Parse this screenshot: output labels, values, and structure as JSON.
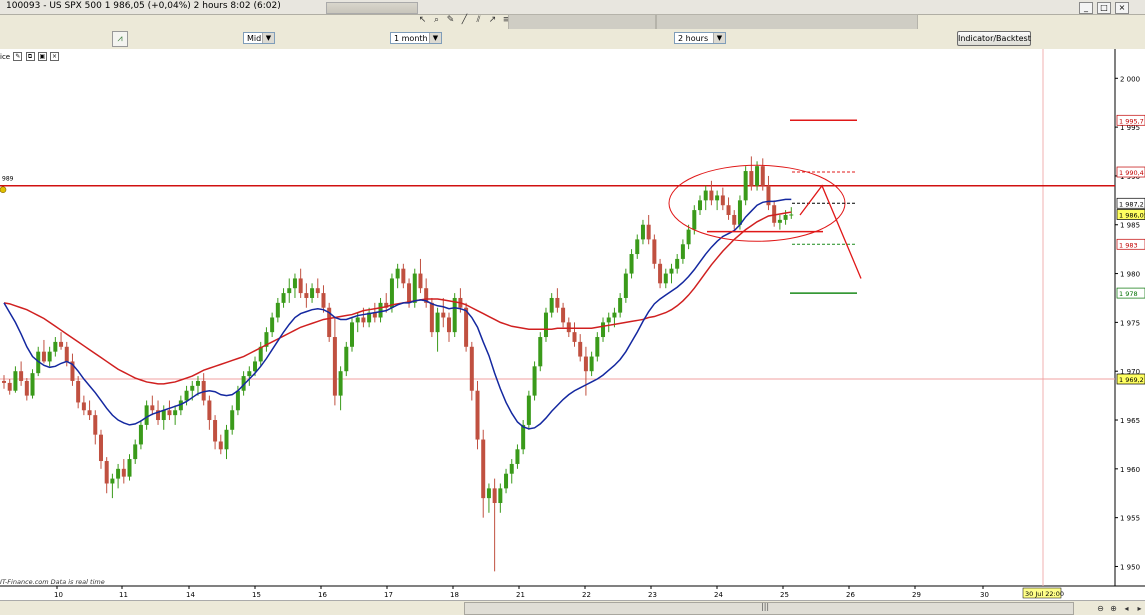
{
  "window": {
    "title": "100093 - US SPX 500     1 986,05 (+0,04%)     2 hours   8:02 (6:02)"
  },
  "toolbar": {
    "icons": [
      "cursor-icon",
      "zoom-icon",
      "draw-icon",
      "line-icon",
      "channel-icon",
      "trendline-icon",
      "fib-icon",
      "fan-icon",
      "text-icon",
      "arrow-icon",
      "delete-icon",
      "settings-icon",
      "chart-icon"
    ]
  },
  "options": {
    "price_mode": "Mid",
    "period": "1 month",
    "interval": "2 hours",
    "indicator_button": "Indicator/Backtest",
    "legend_label": "ice",
    "level_tag": "989"
  },
  "footer": {
    "source": "IT-Finance.com  Data is real time",
    "scroll_grip": "|||"
  },
  "colors": {
    "bull": "#3a9a1a",
    "bear": "#c05040",
    "sma_fast": "#1428a0",
    "sma_slow": "#d02020",
    "annotation_red": "#e01818",
    "annotation_green": "#1a8a1a"
  },
  "chart_data": {
    "type": "candlestick",
    "instrument": "US SPX 500",
    "last_price": 1986.05,
    "change_pct": 0.04,
    "ylim": [
      1948,
      2003
    ],
    "y_ticks": [
      "2 000",
      "1 995",
      "1 990",
      "1 985",
      "1 980",
      "1 975",
      "1 970",
      "1 965",
      "1 960",
      "1 955",
      "1 950"
    ],
    "x_ticks": [
      "10",
      "11",
      "14",
      "15",
      "16",
      "17",
      "18",
      "21",
      "22",
      "23",
      "24",
      "25",
      "26",
      "29",
      "30"
    ],
    "x_highlight": "30 Jul 22:00",
    "price_labels": [
      "1 995,7",
      "1 990,4",
      "1 987,2",
      "1 986,05",
      "1 983",
      "1 978",
      "1 969,2"
    ],
    "levels": {
      "resistance": 1989,
      "support": 1969.2,
      "target_high": 1995.7,
      "stop": 1990.4,
      "entry": 1987.2,
      "lower": 1983,
      "target_low": 1978
    },
    "candles": [
      [
        1969.0,
        1969.6,
        1968.2,
        1968.8
      ],
      [
        1968.8,
        1969.2,
        1967.6,
        1968.0
      ],
      [
        1968.0,
        1970.5,
        1967.8,
        1970.0
      ],
      [
        1970.0,
        1971.0,
        1968.5,
        1969.0
      ],
      [
        1969.0,
        1969.3,
        1967.0,
        1967.5
      ],
      [
        1967.5,
        1970.2,
        1967.2,
        1969.8
      ],
      [
        1969.8,
        1972.5,
        1969.5,
        1972.0
      ],
      [
        1972.0,
        1973.2,
        1970.8,
        1971.0
      ],
      [
        1971.0,
        1972.5,
        1970.5,
        1972.0
      ],
      [
        1972.0,
        1973.5,
        1971.5,
        1973.0
      ],
      [
        1973.0,
        1974.0,
        1972.2,
        1972.5
      ],
      [
        1972.5,
        1973.0,
        1970.5,
        1971.0
      ],
      [
        1971.0,
        1971.8,
        1968.5,
        1969.0
      ],
      [
        1969.0,
        1969.5,
        1966.2,
        1966.8
      ],
      [
        1966.8,
        1967.5,
        1965.5,
        1966.0
      ],
      [
        1966.0,
        1967.0,
        1965.0,
        1965.5
      ],
      [
        1965.5,
        1966.0,
        1962.5,
        1963.5
      ],
      [
        1963.5,
        1964.0,
        1960.0,
        1960.8
      ],
      [
        1960.8,
        1961.2,
        1957.5,
        1958.5
      ],
      [
        1958.5,
        1959.5,
        1957.0,
        1959.0
      ],
      [
        1959.0,
        1960.5,
        1958.0,
        1960.0
      ],
      [
        1960.0,
        1961.0,
        1958.5,
        1959.2
      ],
      [
        1959.2,
        1961.5,
        1958.8,
        1961.0
      ],
      [
        1961.0,
        1963.0,
        1960.5,
        1962.5
      ],
      [
        1962.5,
        1965.0,
        1962.0,
        1964.5
      ],
      [
        1964.5,
        1967.0,
        1964.0,
        1966.5
      ],
      [
        1966.5,
        1967.5,
        1965.5,
        1966.0
      ],
      [
        1966.0,
        1967.0,
        1964.5,
        1965.0
      ],
      [
        1965.0,
        1966.5,
        1964.0,
        1966.0
      ],
      [
        1966.0,
        1967.0,
        1965.0,
        1965.5
      ],
      [
        1965.5,
        1966.5,
        1964.5,
        1966.0
      ],
      [
        1966.0,
        1967.5,
        1965.5,
        1967.0
      ],
      [
        1967.0,
        1968.5,
        1966.5,
        1968.0
      ],
      [
        1968.0,
        1969.0,
        1967.0,
        1968.5
      ],
      [
        1968.5,
        1969.5,
        1967.5,
        1969.0
      ],
      [
        1969.0,
        1969.8,
        1966.5,
        1967.0
      ],
      [
        1967.0,
        1967.5,
        1964.0,
        1965.0
      ],
      [
        1965.0,
        1965.5,
        1962.0,
        1962.8
      ],
      [
        1962.8,
        1963.5,
        1961.5,
        1962.0
      ],
      [
        1962.0,
        1964.5,
        1961.0,
        1964.0
      ],
      [
        1964.0,
        1966.5,
        1963.5,
        1966.0
      ],
      [
        1966.0,
        1968.5,
        1965.5,
        1968.0
      ],
      [
        1968.0,
        1970.0,
        1967.5,
        1969.5
      ],
      [
        1969.5,
        1970.5,
        1968.5,
        1970.0
      ],
      [
        1970.0,
        1971.5,
        1969.5,
        1971.0
      ],
      [
        1971.0,
        1973.0,
        1970.5,
        1972.5
      ],
      [
        1972.5,
        1974.5,
        1972.0,
        1974.0
      ],
      [
        1974.0,
        1976.0,
        1973.5,
        1975.5
      ],
      [
        1975.5,
        1977.5,
        1975.0,
        1977.0
      ],
      [
        1977.0,
        1978.5,
        1976.5,
        1978.0
      ],
      [
        1978.0,
        1979.5,
        1977.0,
        1978.5
      ],
      [
        1978.5,
        1980.0,
        1977.5,
        1979.5
      ],
      [
        1979.5,
        1980.5,
        1977.5,
        1978.0
      ],
      [
        1978.0,
        1979.0,
        1976.5,
        1977.5
      ],
      [
        1977.5,
        1979.0,
        1977.0,
        1978.5
      ],
      [
        1978.5,
        1979.5,
        1977.5,
        1978.0
      ],
      [
        1978.0,
        1978.8,
        1976.0,
        1976.5
      ],
      [
        1976.5,
        1977.0,
        1973.0,
        1973.5
      ],
      [
        1973.5,
        1975.5,
        1966.5,
        1967.5
      ],
      [
        1967.5,
        1970.5,
        1966.0,
        1970.0
      ],
      [
        1970.0,
        1973.0,
        1969.5,
        1972.5
      ],
      [
        1972.5,
        1975.5,
        1972.0,
        1975.0
      ],
      [
        1975.0,
        1976.0,
        1974.0,
        1975.5
      ],
      [
        1975.5,
        1976.5,
        1974.5,
        1975.0
      ],
      [
        1975.0,
        1976.5,
        1974.5,
        1976.0
      ],
      [
        1976.0,
        1977.0,
        1975.0,
        1975.5
      ],
      [
        1975.5,
        1977.5,
        1975.0,
        1977.0
      ],
      [
        1977.0,
        1978.0,
        1976.0,
        1976.5
      ],
      [
        1976.5,
        1980.0,
        1976.0,
        1979.5
      ],
      [
        1979.5,
        1981.0,
        1978.5,
        1980.5
      ],
      [
        1980.5,
        1981.0,
        1978.5,
        1979.0
      ],
      [
        1979.0,
        1979.5,
        1976.5,
        1977.0
      ],
      [
        1977.0,
        1980.5,
        1976.5,
        1980.0
      ],
      [
        1980.0,
        1981.5,
        1978.0,
        1978.5
      ],
      [
        1978.5,
        1979.5,
        1976.5,
        1977.0
      ],
      [
        1977.0,
        1977.5,
        1973.5,
        1974.0
      ],
      [
        1974.0,
        1976.5,
        1972.0,
        1976.0
      ],
      [
        1976.0,
        1977.5,
        1974.5,
        1975.5
      ],
      [
        1975.5,
        1976.0,
        1973.0,
        1974.0
      ],
      [
        1974.0,
        1978.0,
        1973.5,
        1977.5
      ],
      [
        1977.5,
        1978.5,
        1976.0,
        1976.5
      ],
      [
        1976.5,
        1977.0,
        1972.0,
        1972.5
      ],
      [
        1972.5,
        1973.0,
        1967.0,
        1968.0
      ],
      [
        1968.0,
        1969.0,
        1962.0,
        1963.0
      ],
      [
        1963.0,
        1964.0,
        1955.0,
        1957.0
      ],
      [
        1957.0,
        1958.5,
        1955.5,
        1958.0
      ],
      [
        1958.0,
        1959.0,
        1949.5,
        1956.5
      ],
      [
        1956.5,
        1958.5,
        1955.5,
        1958.0
      ],
      [
        1958.0,
        1960.0,
        1957.5,
        1959.5
      ],
      [
        1959.5,
        1961.0,
        1958.5,
        1960.5
      ],
      [
        1960.5,
        1962.5,
        1960.0,
        1962.0
      ],
      [
        1962.0,
        1965.0,
        1961.5,
        1964.5
      ],
      [
        1964.5,
        1968.0,
        1964.0,
        1967.5
      ],
      [
        1967.5,
        1971.0,
        1967.0,
        1970.5
      ],
      [
        1970.5,
        1974.0,
        1970.0,
        1973.5
      ],
      [
        1973.5,
        1976.5,
        1973.0,
        1976.0
      ],
      [
        1976.0,
        1978.0,
        1975.5,
        1977.5
      ],
      [
        1977.5,
        1978.5,
        1976.0,
        1976.5
      ],
      [
        1976.5,
        1977.0,
        1974.5,
        1975.0
      ],
      [
        1975.0,
        1975.5,
        1973.5,
        1974.0
      ],
      [
        1974.0,
        1975.0,
        1972.5,
        1973.0
      ],
      [
        1973.0,
        1973.8,
        1971.0,
        1971.5
      ],
      [
        1971.5,
        1972.5,
        1967.5,
        1970.0
      ],
      [
        1970.0,
        1972.0,
        1969.5,
        1971.5
      ],
      [
        1971.5,
        1974.0,
        1971.0,
        1973.5
      ],
      [
        1973.5,
        1975.5,
        1973.0,
        1975.0
      ],
      [
        1975.0,
        1976.0,
        1974.0,
        1975.5
      ],
      [
        1975.5,
        1976.5,
        1974.5,
        1976.0
      ],
      [
        1976.0,
        1978.0,
        1975.5,
        1977.5
      ],
      [
        1977.5,
        1980.5,
        1977.0,
        1980.0
      ],
      [
        1980.0,
        1982.5,
        1979.5,
        1982.0
      ],
      [
        1982.0,
        1984.0,
        1981.5,
        1983.5
      ],
      [
        1983.5,
        1985.5,
        1983.0,
        1985.0
      ],
      [
        1985.0,
        1986.0,
        1983.0,
        1983.5
      ],
      [
        1983.5,
        1984.0,
        1980.5,
        1981.0
      ],
      [
        1981.0,
        1981.5,
        1978.5,
        1979.0
      ],
      [
        1979.0,
        1980.5,
        1978.5,
        1980.0
      ],
      [
        1980.0,
        1981.0,
        1979.0,
        1980.5
      ],
      [
        1980.5,
        1982.0,
        1980.0,
        1981.5
      ],
      [
        1981.5,
        1983.5,
        1981.0,
        1983.0
      ],
      [
        1983.0,
        1985.0,
        1982.5,
        1984.5
      ],
      [
        1984.5,
        1987.0,
        1984.0,
        1986.5
      ],
      [
        1986.5,
        1988.0,
        1986.0,
        1987.5
      ],
      [
        1987.5,
        1989.0,
        1986.5,
        1988.5
      ],
      [
        1988.5,
        1989.5,
        1987.0,
        1987.5
      ],
      [
        1987.5,
        1988.5,
        1986.5,
        1988.0
      ],
      [
        1988.0,
        1988.8,
        1986.5,
        1987.0
      ],
      [
        1987.0,
        1987.8,
        1985.5,
        1986.0
      ],
      [
        1986.0,
        1986.5,
        1984.5,
        1985.0
      ],
      [
        1985.0,
        1988.0,
        1984.5,
        1987.5
      ],
      [
        1987.5,
        1991.0,
        1987.0,
        1990.5
      ],
      [
        1990.5,
        1992.0,
        1988.5,
        1989.0
      ],
      [
        1989.0,
        1991.5,
        1988.5,
        1991.0
      ],
      [
        1991.0,
        1991.8,
        1988.5,
        1989.0
      ],
      [
        1989.0,
        1990.0,
        1986.5,
        1987.0
      ],
      [
        1987.0,
        1987.5,
        1984.8,
        1985.2
      ],
      [
        1985.2,
        1986.0,
        1984.5,
        1985.5
      ],
      [
        1985.5,
        1986.5,
        1985.0,
        1986.0
      ],
      [
        1986.0,
        1986.8,
        1985.6,
        1986.05
      ]
    ],
    "series": [
      {
        "name": "",
        "values": [
          1977.0,
          1976.0,
          1975.0,
          1973.8,
          1972.5,
          1971.5,
          1971.0,
          1970.6,
          1970.4,
          1970.5,
          1970.8,
          1971.0,
          1970.7,
          1970.0,
          1969.2,
          1968.5,
          1967.8,
          1967.0,
          1966.2,
          1965.5,
          1965.0,
          1964.7,
          1964.5,
          1964.6,
          1964.9,
          1965.3,
          1965.6,
          1965.8,
          1966.0,
          1966.2,
          1966.4,
          1966.6,
          1966.9,
          1967.3,
          1967.7,
          1967.9,
          1968.0,
          1967.9,
          1967.6,
          1967.5,
          1967.6,
          1968.0,
          1968.6,
          1969.2,
          1969.8,
          1970.5,
          1971.3,
          1972.2,
          1973.1,
          1974.0,
          1974.8,
          1975.5,
          1975.9,
          1976.1,
          1976.3,
          1976.4,
          1976.3,
          1976.0,
          1975.5,
          1975.3,
          1975.3,
          1975.5,
          1975.7,
          1975.8,
          1975.9,
          1976.0,
          1976.1,
          1976.2,
          1976.5,
          1976.8,
          1977.0,
          1977.0,
          1977.2,
          1977.3,
          1977.2,
          1976.9,
          1976.7,
          1976.6,
          1976.4,
          1976.5,
          1976.4,
          1976.2,
          1975.5,
          1974.5,
          1973.0,
          1971.6,
          1969.8,
          1968.2,
          1966.8,
          1965.7,
          1964.8,
          1964.3,
          1964.1,
          1964.2,
          1964.6,
          1965.2,
          1965.9,
          1966.5,
          1967.1,
          1967.6,
          1968.0,
          1968.3,
          1968.6,
          1968.9,
          1969.2,
          1969.6,
          1970.1,
          1970.6,
          1971.2,
          1972.0,
          1973.0,
          1974.0,
          1975.1,
          1976.1,
          1976.9,
          1977.4,
          1977.8,
          1978.2,
          1978.6,
          1979.1,
          1979.7,
          1980.4,
          1981.2,
          1982.0,
          1982.7,
          1983.3,
          1983.8,
          1984.1,
          1984.4,
          1985.0,
          1985.8,
          1986.4,
          1987.0,
          1987.3,
          1987.4,
          1987.4,
          1987.5,
          1987.6,
          1987.6
        ]
      },
      {
        "name": "",
        "values": [
          1977.0,
          1976.9,
          1976.7,
          1976.5,
          1976.3,
          1976.0,
          1975.7,
          1975.4,
          1975.0,
          1974.6,
          1974.2,
          1973.8,
          1973.4,
          1973.0,
          1972.6,
          1972.2,
          1971.8,
          1971.4,
          1971.0,
          1970.6,
          1970.2,
          1969.9,
          1969.6,
          1969.3,
          1969.1,
          1968.9,
          1968.8,
          1968.7,
          1968.7,
          1968.8,
          1968.9,
          1969.1,
          1969.3,
          1969.5,
          1969.8,
          1970.1,
          1970.3,
          1970.5,
          1970.7,
          1970.9,
          1971.1,
          1971.3,
          1971.5,
          1971.8,
          1972.1,
          1972.4,
          1972.7,
          1973.0,
          1973.3,
          1973.6,
          1973.9,
          1974.2,
          1974.5,
          1974.7,
          1974.9,
          1975.1,
          1975.3,
          1975.4,
          1975.5,
          1975.6,
          1975.7,
          1975.8,
          1976.0,
          1976.2,
          1976.3,
          1976.4,
          1976.5,
          1976.6,
          1976.8,
          1976.9,
          1977.0,
          1977.1,
          1977.2,
          1977.3,
          1977.4,
          1977.4,
          1977.4,
          1977.3,
          1977.2,
          1977.1,
          1977.0,
          1976.8,
          1976.5,
          1976.2,
          1975.9,
          1975.6,
          1975.3,
          1975.0,
          1974.8,
          1974.6,
          1974.5,
          1974.4,
          1974.3,
          1974.3,
          1974.3,
          1974.3,
          1974.3,
          1974.4,
          1974.4,
          1974.4,
          1974.4,
          1974.4,
          1974.4,
          1974.4,
          1974.5,
          1974.6,
          1974.7,
          1974.8,
          1974.9,
          1975.0,
          1975.1,
          1975.2,
          1975.3,
          1975.5,
          1975.6,
          1975.8,
          1976.0,
          1976.3,
          1976.7,
          1977.2,
          1977.8,
          1978.5,
          1979.3,
          1980.1,
          1980.9,
          1981.6,
          1982.3,
          1982.9,
          1983.5,
          1984.0,
          1984.5,
          1984.9,
          1985.3,
          1985.6,
          1985.9,
          1986.0,
          1986.1,
          1986.2,
          1986.3
        ]
      }
    ]
  }
}
